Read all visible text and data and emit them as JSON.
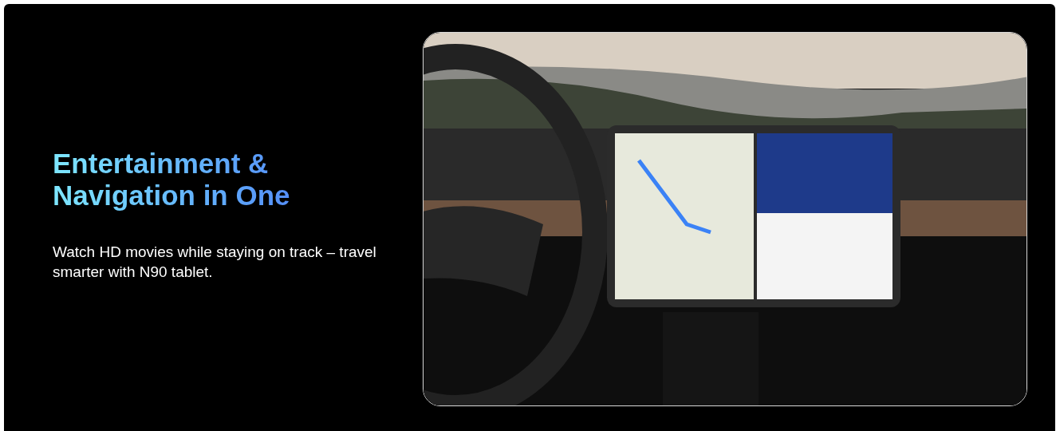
{
  "banner": {
    "title": "Entertainment & Navigation in One",
    "description": "Watch HD movies while staying on track – travel smarter with N90 tablet."
  }
}
